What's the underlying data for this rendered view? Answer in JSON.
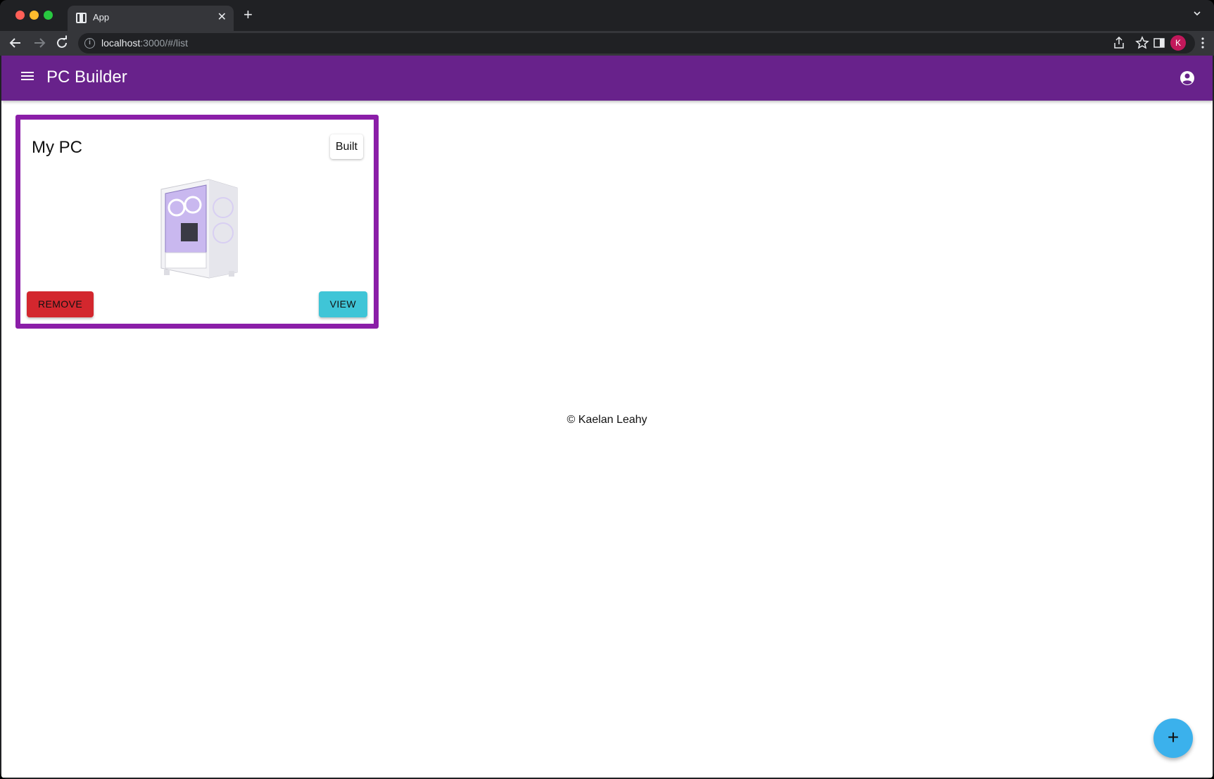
{
  "browser": {
    "tab_title": "App",
    "url_host": "localhost",
    "url_path": ":3000/#/list",
    "profile_initial": "K"
  },
  "app": {
    "title": "PC Builder",
    "brand_color": "#68228b"
  },
  "card": {
    "title": "My PC",
    "status": "Built",
    "remove_label": "REMOVE",
    "view_label": "VIEW",
    "border_color": "#8b1ea8"
  },
  "footer": {
    "text": "© Kaelan Leahy"
  },
  "fab": {
    "label": "+",
    "color": "#3bb1ec"
  },
  "icons": {
    "menu": "hamburger-menu-icon",
    "account": "account-circle-icon",
    "add": "plus-icon"
  }
}
